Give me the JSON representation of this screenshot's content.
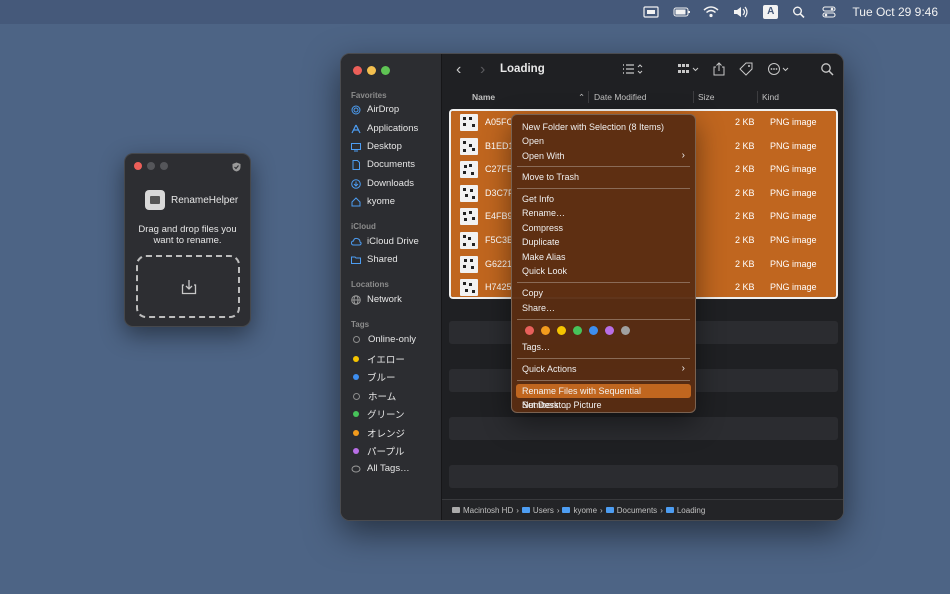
{
  "menubar": {
    "clock": "Tue Oct 29  9:46",
    "input_badge": "A"
  },
  "helper": {
    "app_name": "RenameHelper",
    "message": "Drag and drop files you want to rename."
  },
  "finder": {
    "title": "Loading",
    "sidebar": {
      "favorites_label": "Favorites",
      "favorites": [
        "AirDrop",
        "Applications",
        "Desktop",
        "Documents",
        "Downloads",
        "kyome"
      ],
      "icloud_label": "iCloud",
      "icloud": [
        "iCloud Drive",
        "Shared"
      ],
      "locations_label": "Locations",
      "locations": [
        "Network"
      ],
      "tags_label": "Tags",
      "tags": [
        {
          "label": "Online-only",
          "color": "none"
        },
        {
          "label": "イエロー",
          "color": "#f5c400"
        },
        {
          "label": "ブルー",
          "color": "#3d8ef0"
        },
        {
          "label": "ホーム",
          "color": "none"
        },
        {
          "label": "グリーン",
          "color": "#47c35a"
        },
        {
          "label": "オレンジ",
          "color": "#f29b1d"
        },
        {
          "label": "パープル",
          "color": "#b86ee6"
        },
        {
          "label": "All Tags…",
          "color": "all"
        }
      ]
    },
    "columns": {
      "name": "Name",
      "date": "Date Modified",
      "size": "Size",
      "kind": "Kind"
    },
    "files": [
      {
        "name": "A05FC",
        "size": "2 KB",
        "kind": "PNG image"
      },
      {
        "name": "B1ED1",
        "size": "2 KB",
        "kind": "PNG image"
      },
      {
        "name": "C27FB",
        "size": "2 KB",
        "kind": "PNG image"
      },
      {
        "name": "D3C7F",
        "size": "2 KB",
        "kind": "PNG image"
      },
      {
        "name": "E4FB9",
        "size": "2 KB",
        "kind": "PNG image"
      },
      {
        "name": "F5C3E",
        "size": "2 KB",
        "kind": "PNG image"
      },
      {
        "name": "G6221",
        "size": "2 KB",
        "kind": "PNG image"
      },
      {
        "name": "H7425",
        "size": "2 KB",
        "kind": "PNG image"
      }
    ],
    "path": [
      "Macintosh HD",
      "Users",
      "kyome",
      "Documents",
      "Loading"
    ]
  },
  "context_menu": {
    "new_folder": "New Folder with Selection (8 Items)",
    "open": "Open",
    "open_with": "Open With",
    "trash": "Move to Trash",
    "get_info": "Get Info",
    "rename": "Rename…",
    "compress": "Compress",
    "duplicate": "Duplicate",
    "alias": "Make Alias",
    "quick_look": "Quick Look",
    "copy": "Copy",
    "share": "Share…",
    "tag_colors": [
      "#e8605b",
      "#f29b1d",
      "#f5c400",
      "#47c35a",
      "#3d8ef0",
      "#b86ee6",
      "#a0a0a0"
    ],
    "tags": "Tags…",
    "quick_actions": "Quick Actions",
    "rename_seq": "Rename Files with Sequential Numbers…",
    "desktop_picture": "Set Desktop Picture"
  }
}
